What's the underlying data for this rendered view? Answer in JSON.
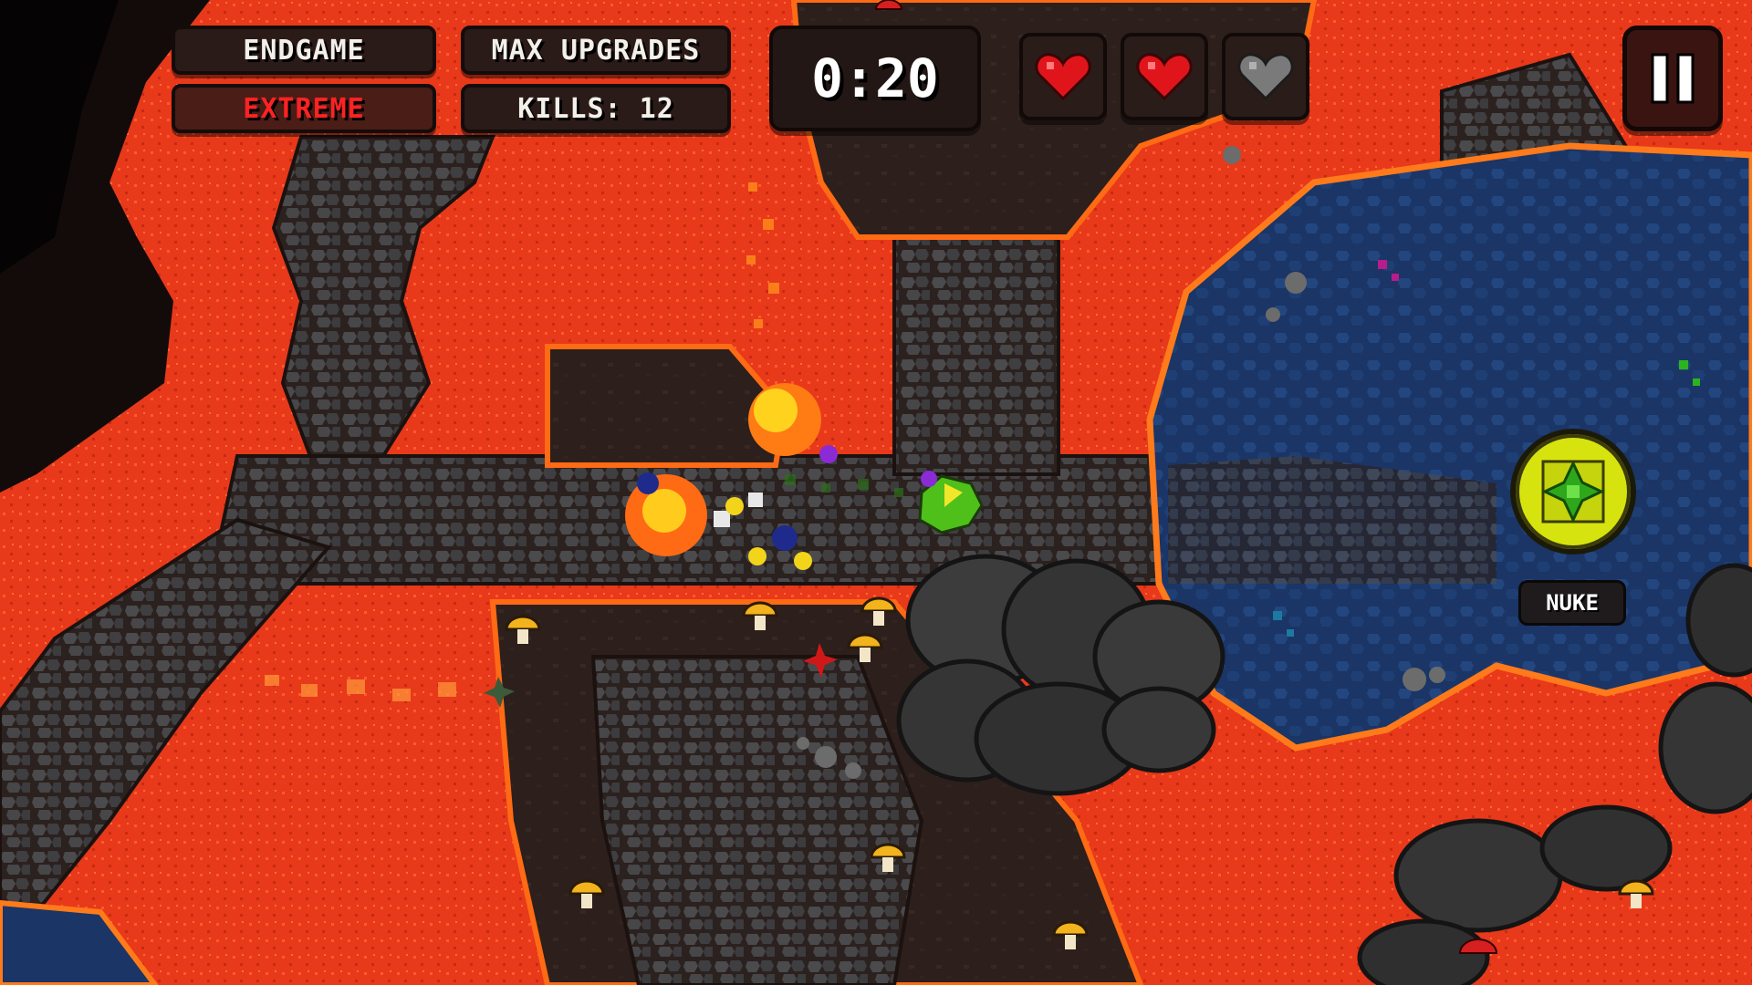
{
  "hud": {
    "mode": "ENDGAME",
    "difficulty": "EXTREME",
    "upgrades": "MAX UPGRADES",
    "kills": "KILLS: 12",
    "timer": "0:20",
    "hearts": [
      {
        "state": "full"
      },
      {
        "state": "full"
      },
      {
        "state": "empty"
      }
    ]
  },
  "ability": {
    "label": "NUKE"
  },
  "colors": {
    "lava": "#e8391a",
    "rock_path": "#2b211f",
    "water": "#1a3566",
    "heart_full": "#e0151b",
    "heart_empty": "#7a7a7a",
    "nuke": "#d7e30f",
    "difficulty_text": "#ff2222"
  },
  "icons": [
    "heart-icon",
    "pause-icon",
    "nuke-icon",
    "mushroom-icon",
    "player-ship-icon"
  ]
}
